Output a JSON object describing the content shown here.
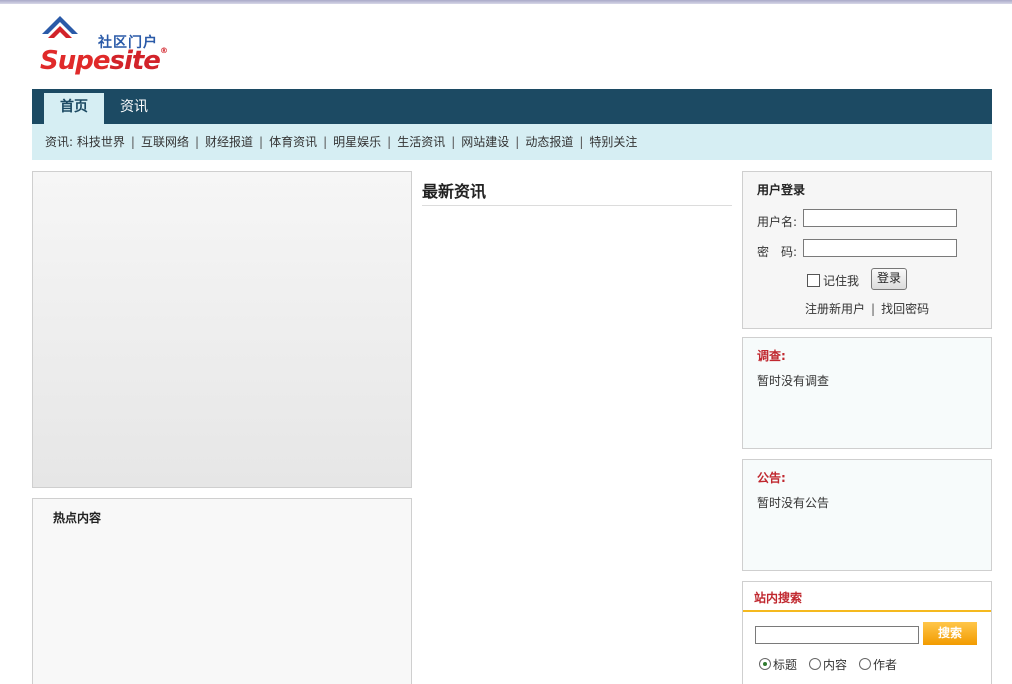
{
  "logo": {
    "text_cn": "社区门户",
    "text_en_supe": "Supe",
    "text_en_site": "site",
    "registered": "®"
  },
  "nav": {
    "tabs": [
      {
        "label": "首页",
        "active": true
      },
      {
        "label": "资讯",
        "active": false
      }
    ]
  },
  "subnav": {
    "prefix": "资讯:",
    "items": [
      "科技世界",
      "互联网络",
      "财经报道",
      "体育资讯",
      "明星娱乐",
      "生活资讯",
      "网站建设",
      "动态报道",
      "特别关注"
    ]
  },
  "hot": {
    "title": "热点内容"
  },
  "news": {
    "title": "最新资讯"
  },
  "login": {
    "title": "用户登录",
    "username_label": "用户名:",
    "password_label": "密　码:",
    "username_value": "",
    "password_value": "",
    "remember_label": "记住我",
    "login_button": "登录",
    "register_link": "注册新用户",
    "separator": "|",
    "forgot_link": "找回密码"
  },
  "survey": {
    "title": "调查:",
    "text": "暂时没有调查"
  },
  "notice": {
    "title": "公告:",
    "text": "暂时没有公告"
  },
  "search": {
    "title": "站内搜索",
    "keyword_value": "",
    "button": "搜索",
    "options": [
      {
        "label": "标题",
        "selected": true
      },
      {
        "label": "内容",
        "selected": false
      },
      {
        "label": "作者",
        "selected": false
      }
    ]
  },
  "colors": {
    "nav_bg": "#1c4a63",
    "subnav_bg": "#d6eef3",
    "title_red": "#c0282f",
    "search_button": "#f29b00"
  }
}
